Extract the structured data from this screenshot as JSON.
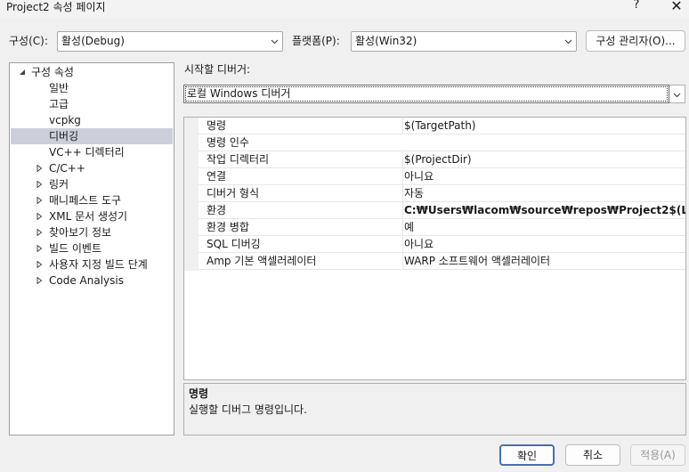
{
  "window": {
    "title": "Project2 속성 페이지",
    "help_glyph": "?",
    "close_glyph": "✕"
  },
  "config": {
    "label": "구성(C):",
    "value": "활성(Debug)",
    "platform_label": "플랫폼(P):",
    "platform_value": "활성(Win32)",
    "manager_button": "구성 관리자(O)..."
  },
  "tree": {
    "items": [
      {
        "label": "구성 속성",
        "arrow": "expanded"
      },
      {
        "label": "일반",
        "arrow": "none"
      },
      {
        "label": "고급",
        "arrow": "none"
      },
      {
        "label": "vcpkg",
        "arrow": "none"
      },
      {
        "label": "디버깅",
        "arrow": "none",
        "selected": true
      },
      {
        "label": "VC++ 디렉터리",
        "arrow": "none"
      },
      {
        "label": "C/C++",
        "arrow": "collapsed"
      },
      {
        "label": "링커",
        "arrow": "collapsed"
      },
      {
        "label": "매니페스트 도구",
        "arrow": "collapsed"
      },
      {
        "label": "XML 문서 생성기",
        "arrow": "collapsed"
      },
      {
        "label": "찾아보기 정보",
        "arrow": "collapsed"
      },
      {
        "label": "빌드 이벤트",
        "arrow": "collapsed"
      },
      {
        "label": "사용자 지정 빌드 단계",
        "arrow": "collapsed"
      },
      {
        "label": "Code Analysis",
        "arrow": "collapsed"
      }
    ]
  },
  "debugger": {
    "label": "시작할 디버거:",
    "value": "로컬 Windows 디버거"
  },
  "properties": [
    {
      "name": "명령",
      "value": "$(TargetPath)",
      "bold": false
    },
    {
      "name": "명령 인수",
      "value": "",
      "bold": false
    },
    {
      "name": "작업 디렉터리",
      "value": "$(ProjectDir)",
      "bold": false
    },
    {
      "name": "연결",
      "value": "아니요",
      "bold": false
    },
    {
      "name": "디버거 형식",
      "value": "자동",
      "bold": false
    },
    {
      "name": "환경",
      "value": "C:₩Users₩lacom₩source₩repos₩Project2$(LocalDebug",
      "bold": true
    },
    {
      "name": "환경 병합",
      "value": "예",
      "bold": false
    },
    {
      "name": "SQL 디버깅",
      "value": "아니요",
      "bold": false
    },
    {
      "name": "Amp 기본 액셀러레이터",
      "value": "WARP 소프트웨어 액셀러레이터",
      "bold": false
    }
  ],
  "description": {
    "title": "명령",
    "text": "실행할 디버그 명령입니다."
  },
  "buttons": {
    "ok": "확인",
    "cancel": "취소",
    "apply": "적용(A)"
  },
  "colors": {
    "selection": "#ccced9",
    "primary_border": "#4a6fb0"
  }
}
